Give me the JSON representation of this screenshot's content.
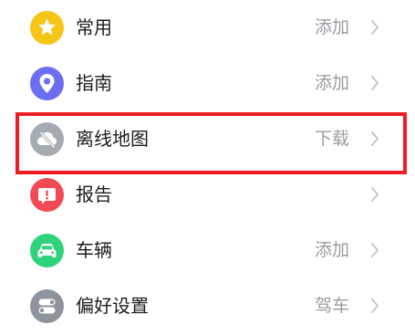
{
  "menu": {
    "items": [
      {
        "label": "常用",
        "action": "添加",
        "icon": "star-icon",
        "color": "#F5C518"
      },
      {
        "label": "指南",
        "action": "添加",
        "icon": "location-pin-icon",
        "color": "#6B6EF2"
      },
      {
        "label": "离线地图",
        "action": "下载",
        "icon": "cloud-offline-icon",
        "color": "#A5ABB3"
      },
      {
        "label": "报告",
        "action": "",
        "icon": "report-alert-icon",
        "color": "#F24A55"
      },
      {
        "label": "车辆",
        "action": "添加",
        "icon": "car-icon",
        "color": "#2FD47A"
      },
      {
        "label": "偏好设置",
        "action": "驾车",
        "icon": "toggle-settings-icon",
        "color": "#8D949D"
      }
    ]
  },
  "highlight": {
    "color": "#EE1D23",
    "target": "离线地图"
  },
  "colors": {
    "text": "#1C1C1E",
    "secondary_text": "#9A9CA1",
    "chevron": "#C5C7CB"
  }
}
